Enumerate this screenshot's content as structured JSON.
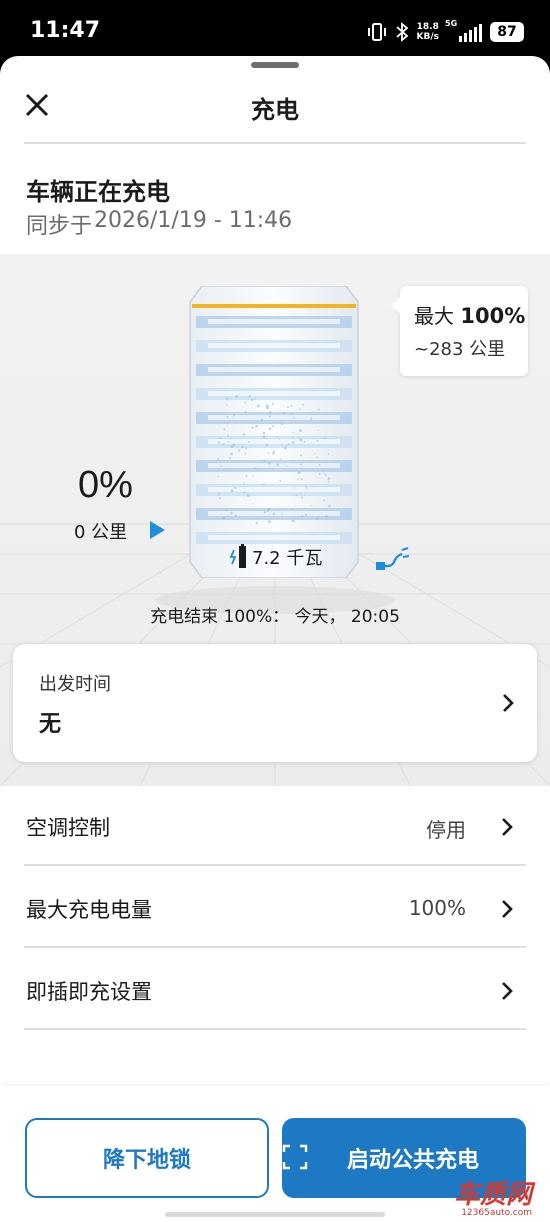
{
  "status_bar": {
    "time": "11:47",
    "net_speed_value": "18.8",
    "net_speed_unit": "KB/s",
    "network": "5G",
    "battery": "87"
  },
  "sheet": {
    "title": "充电"
  },
  "vehicle_status": {
    "title": "车辆正在充电",
    "sync_prefix": "同步于",
    "sync_time": "2026/1/19 - 11:46"
  },
  "battery": {
    "max_prefix": "最大",
    "max_percent": "100%",
    "max_range": "~283 公里",
    "current_percent": "0%",
    "current_range": "0 公里",
    "current_level": 0.0,
    "power": "7.2 千瓦",
    "charge_end": "充电结束 100%： 今天， 20:05"
  },
  "departure": {
    "label": "出发时间",
    "value": "无"
  },
  "settings": [
    {
      "label": "空调控制",
      "value": "停用"
    },
    {
      "label": "最大充电电量",
      "value": "100%"
    },
    {
      "label": "即插即充设置",
      "value": ""
    }
  ],
  "actions": {
    "lower_lock": "降下地锁",
    "start_public": "启动公共充电"
  },
  "watermark": {
    "brand": "车质网",
    "site": "12365auto.com"
  },
  "colors": {
    "accent": "#1d79c4",
    "max_line": "#f2b51c",
    "battery_band": "#7fb3e0"
  }
}
